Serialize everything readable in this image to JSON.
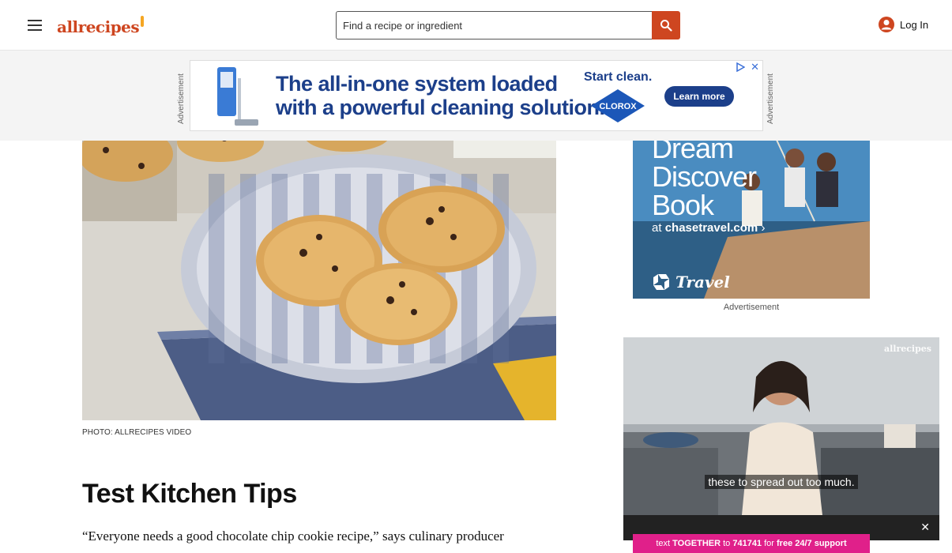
{
  "header": {
    "logo_text": "allrecipes",
    "search_placeholder": "Find a recipe or ingredient",
    "login_label": "Log In"
  },
  "top_ad": {
    "side_label": "Advertisement",
    "headline_line1": "The all-in-one system loaded",
    "headline_line2": "with a powerful cleaning solution.",
    "cta_text": "Start clean.",
    "brand": "CLOROX",
    "button_label": "Learn more",
    "close_label": "✕"
  },
  "article": {
    "photo_caption": "PHOTO: ALLRECIPES VIDEO",
    "section_title": "Test Kitchen Tips",
    "body_text": "“Everyone needs a good chocolate chip cookie recipe,” says culinary producer"
  },
  "side_ad": {
    "line1": "Dream",
    "line2": "Discover",
    "line3": "Book",
    "link_prefix": "at ",
    "link_domain": "chasetravel.com",
    "link_arrow": "›",
    "brand": "Travel",
    "label": "Advertisement"
  },
  "video": {
    "watermark": "allrecipes",
    "caption": "these to spread out too much.",
    "close_label": "✕"
  },
  "pink_banner": {
    "t1": "text ",
    "t2": "TOGETHER",
    "t3": " to ",
    "t4": "741741",
    "t5": " for ",
    "t6": "free 24/7 support"
  }
}
